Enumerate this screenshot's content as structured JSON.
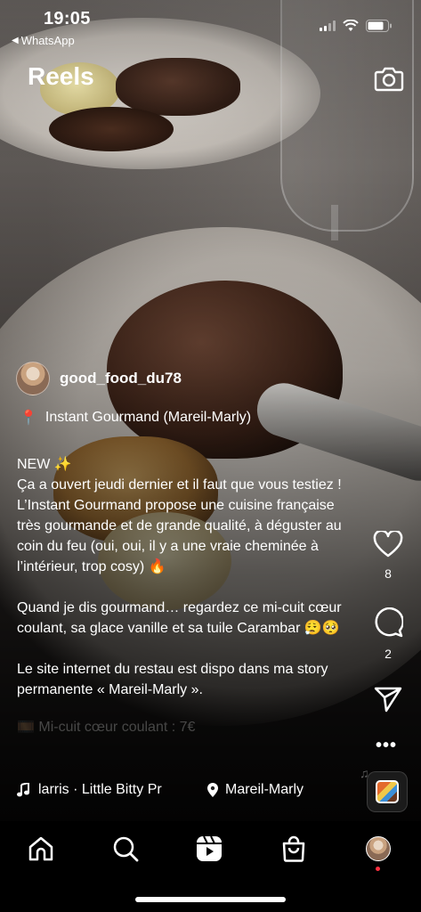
{
  "status_bar": {
    "time": "19:05",
    "back_app": "WhatsApp",
    "icons": [
      "cellular-signal-icon",
      "wifi-icon",
      "battery-icon"
    ]
  },
  "header": {
    "title": "Reels",
    "camera_icon": "camera-icon"
  },
  "post": {
    "username": "good_food_du78",
    "location_emoji": "📍",
    "location": "Instant Gourmand (Mareil-Marly)",
    "caption": [
      "NEW ✨",
      "Ça a ouvert jeudi dernier et il faut que vous testiez ! L’Instant Gourmand propose une cuisine française très gourmande et de grande qualité, à déguster au coin du feu (oui, oui, il y a une vraie cheminée à l’intérieur, trop cosy) 🔥",
      "Quand je dis gourmand… regardez ce mi-cuit cœur coulant, sa glace vanille et sa tuile Carambar 😮‍💨🥺",
      "Le site internet du restau est dispo dans ma story permanente « Mareil-Marly ».",
      "🎞️ Mi-cuit cœur coulant : 7€"
    ],
    "music": "larris · Little Bitty Pr",
    "place": "Mareil-Marly"
  },
  "actions": {
    "likes": "8",
    "comments": "2",
    "more": "•••"
  },
  "tabbar": {
    "items": [
      "home",
      "search",
      "reels",
      "shop",
      "profile"
    ]
  },
  "colors": {
    "background": "#000000",
    "text": "#ffffff",
    "notification_dot": "#ff3040"
  }
}
